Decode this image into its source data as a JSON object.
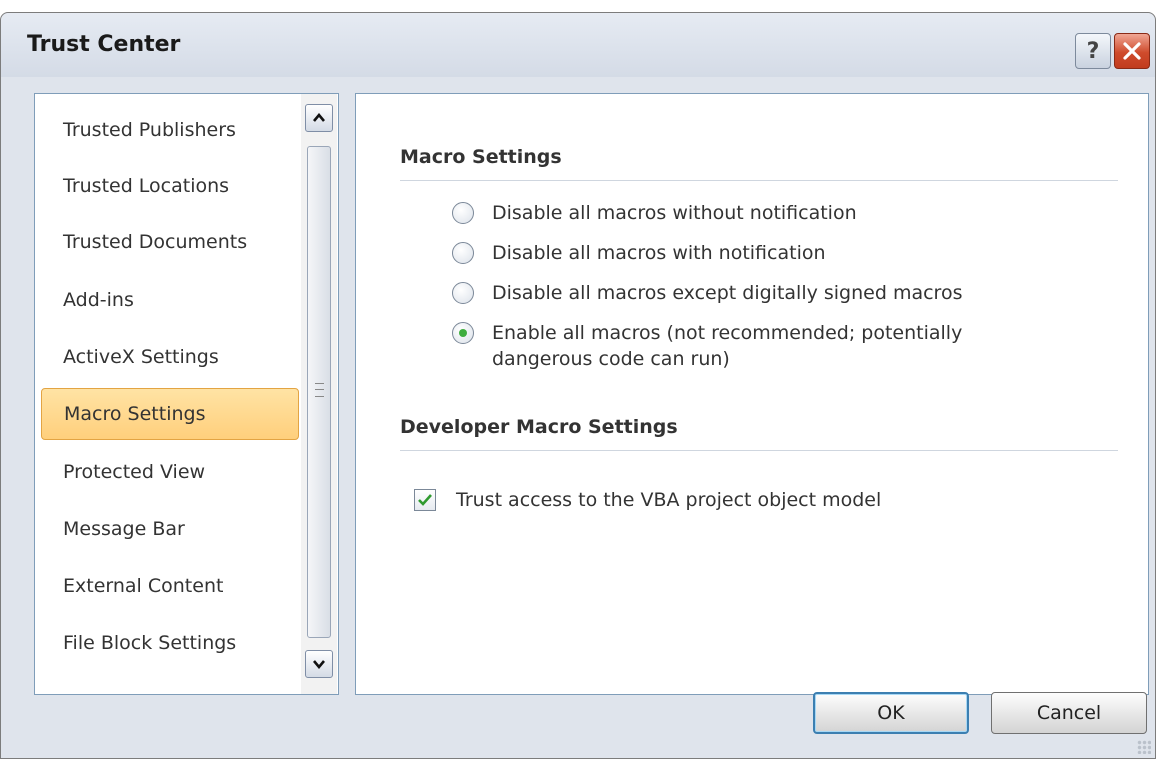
{
  "window": {
    "title": "Trust Center",
    "help_label": "?"
  },
  "nav": {
    "items": [
      {
        "label": "Trusted Publishers",
        "selected": false
      },
      {
        "label": "Trusted Locations",
        "selected": false
      },
      {
        "label": "Trusted Documents",
        "selected": false
      },
      {
        "label": "Add-ins",
        "selected": false
      },
      {
        "label": "ActiveX Settings",
        "selected": false
      },
      {
        "label": "Macro Settings",
        "selected": true
      },
      {
        "label": "Protected View",
        "selected": false
      },
      {
        "label": "Message Bar",
        "selected": false
      },
      {
        "label": "External Content",
        "selected": false
      },
      {
        "label": "File Block Settings",
        "selected": false
      }
    ]
  },
  "macro_settings": {
    "heading": "Macro Settings",
    "options": [
      {
        "label": "Disable all macros without notification",
        "checked": false
      },
      {
        "label": "Disable all macros with notification",
        "checked": false
      },
      {
        "label": "Disable all macros except digitally signed macros",
        "checked": false
      },
      {
        "label": "Enable all macros (not recommended; potentially dangerous code can run)",
        "line1": "Enable all macros (not recommended; potentially",
        "line2": "dangerous code can run)",
        "checked": true
      }
    ]
  },
  "developer_settings": {
    "heading": "Developer Macro Settings",
    "vba_access_label": "Trust access to the VBA project object model",
    "vba_access_checked": true
  },
  "buttons": {
    "ok": "OK",
    "cancel": "Cancel"
  },
  "colors": {
    "selected_bg": "#ffcf7c",
    "pane_border": "#7f9db9",
    "radio_dot": "#3fae3f",
    "close_red": "#cf4b2c"
  }
}
